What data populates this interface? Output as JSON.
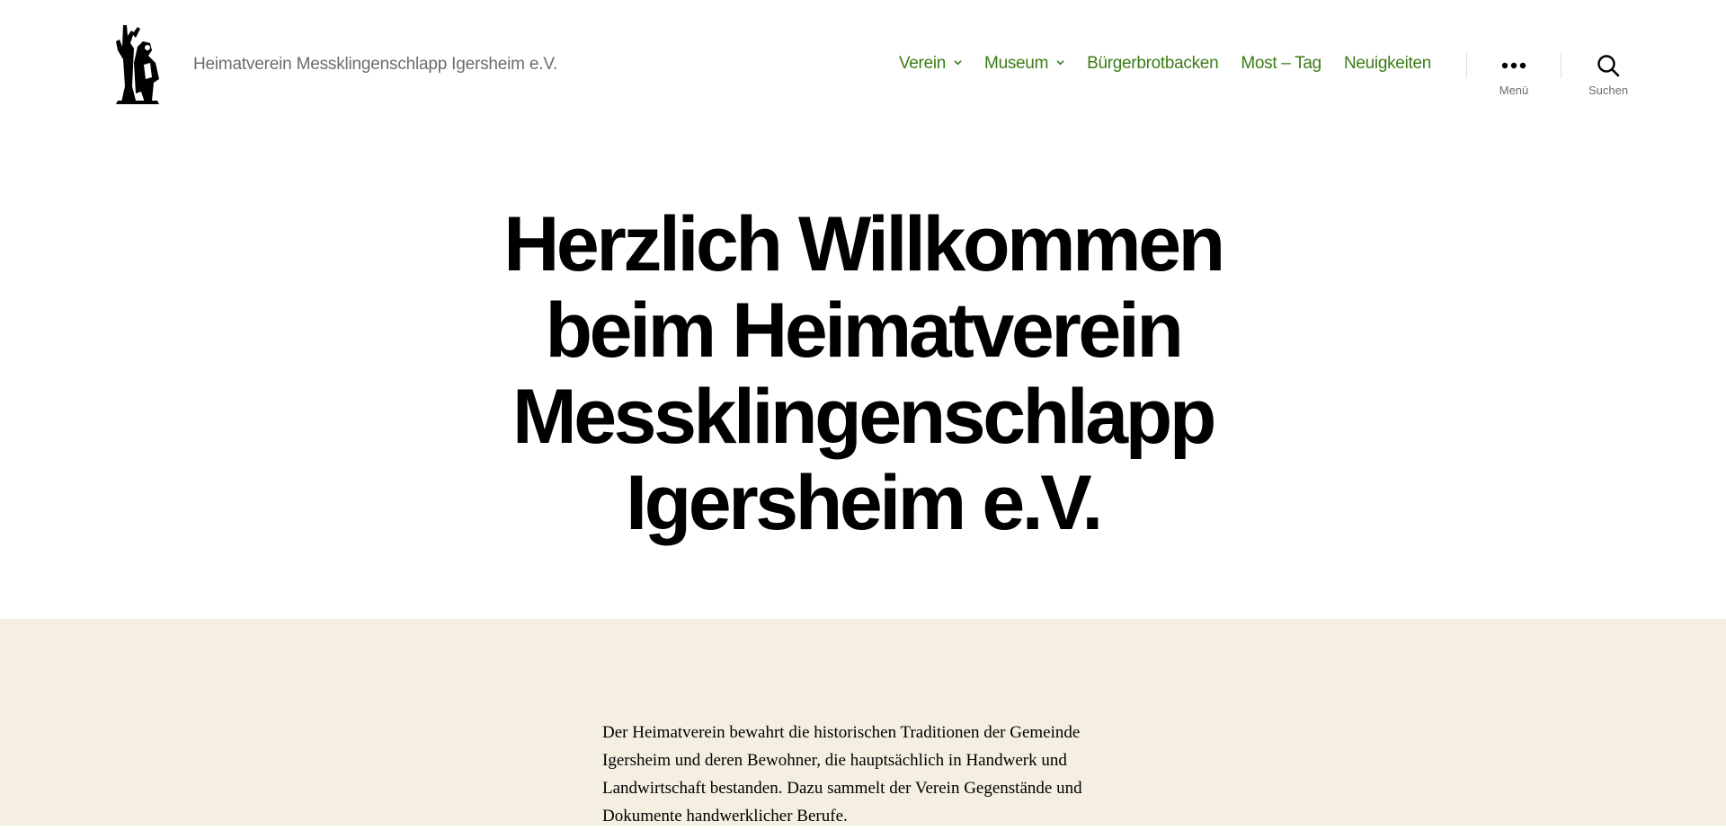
{
  "site": {
    "title": "Heimatverein Messklingenschlapp Igersheim e.V.",
    "logo_icon": "tree-figure-logo-icon",
    "accent_color": "#3b7d16",
    "content_bg": "#f4efe1"
  },
  "nav": {
    "items": [
      {
        "label": "Verein",
        "has_submenu": true
      },
      {
        "label": "Museum",
        "has_submenu": true
      },
      {
        "label": "Bürgerbrotbacken",
        "has_submenu": false
      },
      {
        "label": "Most – Tag",
        "has_submenu": false
      },
      {
        "label": "Neuigkeiten",
        "has_submenu": false
      }
    ]
  },
  "menu_toggle": {
    "label": "Menü",
    "icon": "ellipsis-icon"
  },
  "search_toggle": {
    "label": "Suchen",
    "icon": "search-icon"
  },
  "hero": {
    "title_lines": [
      "Herzlich Willkommen",
      "beim Heimatverein",
      "Messklingenschlapp",
      "Igersheim e.V."
    ]
  },
  "content": {
    "intro_lines": [
      "Der Heimatverein bewahrt die historischen Traditionen der Gemeinde",
      "Igersheim und deren Bewohner, die hauptsächlich in Handwerk und",
      "Landwirtschaft bestanden. Dazu sammelt der Verein Gegenstände und",
      "Dokumente handwerklicher Berufe."
    ]
  }
}
